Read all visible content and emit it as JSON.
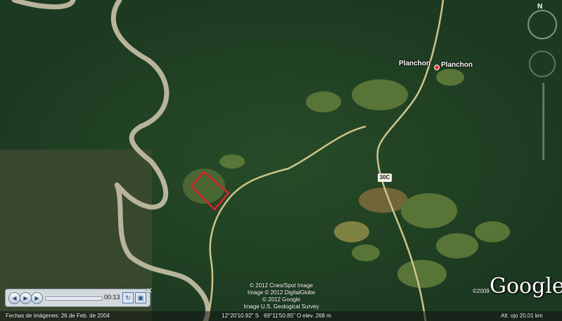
{
  "map": {
    "place_label": "Planchon",
    "place_label_alt": "Planchon",
    "route_label": "30C",
    "logo": "Google",
    "logo_copyright": "©2009",
    "attribution": [
      "© 2012 Cnes/Spot Image",
      "Image © 2012 DigitalGlobe",
      "© 2012 Google",
      "Image U.S. Geological Survey"
    ],
    "highlight_color": "#d8242a"
  },
  "status_bar": {
    "imagery_date": "Fechas de imágenes: 26 de Feb. de 2004",
    "latitude": "12°20'10.92\" S",
    "longitude": "69°11'50.85\" O",
    "elevation": "elev.   268 m",
    "eye_altitude": "Alt. ojo   20.01 km"
  },
  "player": {
    "time": "00:13",
    "icons": [
      "rewind-icon",
      "play-icon",
      "forward-icon",
      "repeat-icon",
      "save-icon",
      "close-icon"
    ]
  },
  "nav": {
    "north_label": "N"
  }
}
